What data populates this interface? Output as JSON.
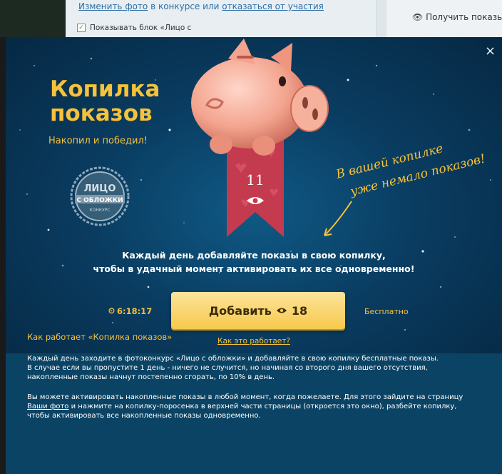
{
  "background": {
    "change_photo_link": "Изменить фото",
    "change_photo_rest": " в конкурсе или ",
    "change_photo_tail": "отказаться от участия",
    "show_block_label": "Показывать блок «Лицо с",
    "get_views_label": "Получить показы"
  },
  "modal": {
    "close": "×",
    "title": "Копилка\nпоказов",
    "subtitle": "Накопил и победил!",
    "badge_line1": "ЛИЦО",
    "badge_line2": "С ОБЛОЖКИ",
    "badge_line3": "КОНКУРС",
    "piggy_count": "11",
    "handwritten_line1": "В вашей копилке",
    "handwritten_line2": "уже немало показов!",
    "description_line1": "Каждый день добавляйте показы в свою копилку,",
    "description_line2": "чтобы в удачный момент активировать их все одновременно!",
    "timer": "6:18:17",
    "add_button_label": "Добавить",
    "add_button_count": "18",
    "free_label": "Бесплатно",
    "how_link": "Как это работает?"
  },
  "info": {
    "title": "Как работает «Копилка показов»",
    "p1_line1": "Каждый день заходите в фотоконкурс «Лицо с обложки» и добавляйте в свою копилку бесплатные показы.",
    "p1_line2": "В случае если вы пропустите 1 день - ничего не случится, но начиная со второго дня вашего отсутствия,",
    "p1_line3": "накопленные показы начнут постепенно сгорать, по 10% в день.",
    "p2_line1": "Вы можете активировать накопленные показы в любой момент, когда пожелаете. Для этого зайдите на страницу",
    "p2_link": "Ваши фото",
    "p2_line2_rest": " и нажмите на копилку-поросенка в верхней части страницы (откроется это окно), разбейте копилку,",
    "p2_line3": "чтобы активировать все накопленные показы одновременно."
  },
  "colors": {
    "accent_yellow": "#f6c23a",
    "modal_dark": "#0a3d62",
    "ribbon_red": "#c43a4f"
  },
  "icons": [
    "close-icon",
    "piggy-bank-image",
    "eye-icon",
    "clock-icon",
    "contest-badge-logo",
    "arrow-doodle"
  ]
}
